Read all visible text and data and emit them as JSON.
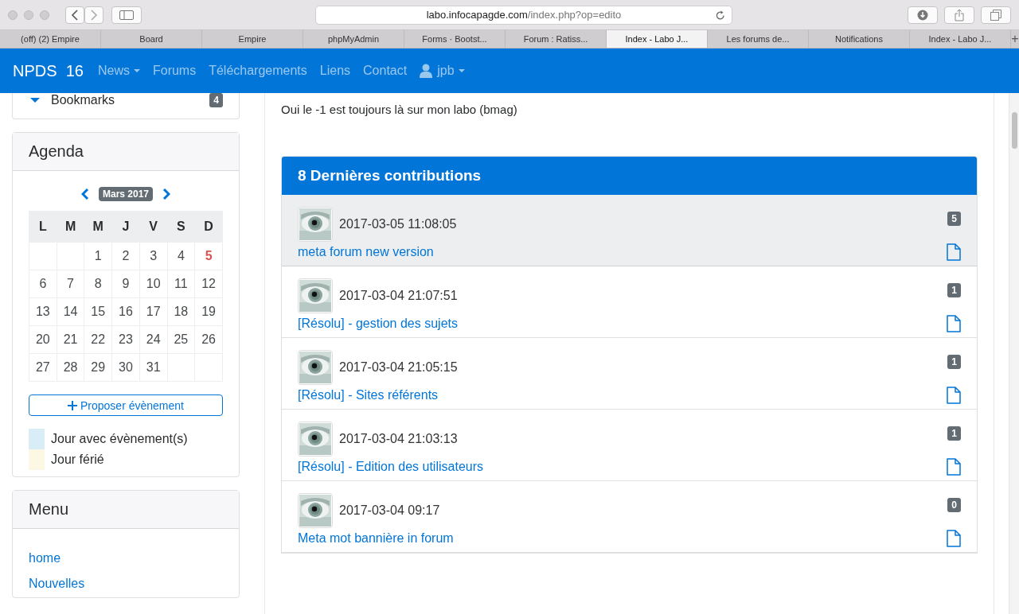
{
  "browser": {
    "address": {
      "host": "labo.infocapagde.com",
      "path": "/index.php?op=edito"
    },
    "tabs": [
      {
        "label": "(off) (2) Empire",
        "selected": false
      },
      {
        "label": "Board",
        "selected": false
      },
      {
        "label": "Empire",
        "selected": false
      },
      {
        "label": "phpMyAdmin",
        "selected": false
      },
      {
        "label": "Forms · Bootst...",
        "selected": false
      },
      {
        "label": "Forum : Ratiss...",
        "selected": false
      },
      {
        "label": "Index - Labo J...",
        "selected": true
      },
      {
        "label": "Les forums de...",
        "selected": false
      },
      {
        "label": "Notifications",
        "selected": false
      },
      {
        "label": "Index - Labo J...",
        "selected": false
      }
    ],
    "new_tab": "+"
  },
  "navbar": {
    "brand": "NPDS  16",
    "items": [
      {
        "label": "News",
        "dropdown": true
      },
      {
        "label": "Forums",
        "dropdown": false
      },
      {
        "label": "Téléchargements",
        "dropdown": false
      },
      {
        "label": "Liens",
        "dropdown": false
      },
      {
        "label": "Contact",
        "dropdown": false
      }
    ],
    "user": {
      "label": "jpb",
      "dropdown": true
    }
  },
  "sidebar": {
    "bookmarks": {
      "label": "Bookmarks",
      "count": "4"
    },
    "agenda": {
      "title": "Agenda",
      "month": "Mars 2017",
      "weekdays": [
        "L",
        "M",
        "M",
        "J",
        "V",
        "S",
        "D"
      ],
      "weeks": [
        [
          {
            "kind": "blank"
          },
          {
            "kind": "blank"
          },
          {
            "kind": "day",
            "day": "1",
            "today": false
          },
          {
            "kind": "day",
            "day": "2",
            "today": false
          },
          {
            "kind": "day",
            "day": "3",
            "today": false
          },
          {
            "kind": "day",
            "day": "4",
            "today": false
          },
          {
            "kind": "day",
            "day": "5",
            "today": true
          }
        ],
        [
          {
            "kind": "day",
            "day": "6",
            "today": false
          },
          {
            "kind": "day",
            "day": "7",
            "today": false
          },
          {
            "kind": "day",
            "day": "8",
            "today": false
          },
          {
            "kind": "day",
            "day": "9",
            "today": false
          },
          {
            "kind": "day",
            "day": "10",
            "today": false
          },
          {
            "kind": "day",
            "day": "11",
            "today": false
          },
          {
            "kind": "day",
            "day": "12",
            "today": false
          }
        ],
        [
          {
            "kind": "day",
            "day": "13",
            "today": false
          },
          {
            "kind": "day",
            "day": "14",
            "today": false
          },
          {
            "kind": "day",
            "day": "15",
            "today": false
          },
          {
            "kind": "day",
            "day": "16",
            "today": false
          },
          {
            "kind": "day",
            "day": "17",
            "today": false
          },
          {
            "kind": "day",
            "day": "18",
            "today": false
          },
          {
            "kind": "day",
            "day": "19",
            "today": false
          }
        ],
        [
          {
            "kind": "day",
            "day": "20",
            "today": false
          },
          {
            "kind": "day",
            "day": "21",
            "today": false
          },
          {
            "kind": "day",
            "day": "22",
            "today": false
          },
          {
            "kind": "day",
            "day": "23",
            "today": false
          },
          {
            "kind": "day",
            "day": "24",
            "today": false
          },
          {
            "kind": "day",
            "day": "25",
            "today": false
          },
          {
            "kind": "day",
            "day": "26",
            "today": false
          }
        ],
        [
          {
            "kind": "day",
            "day": "27",
            "today": false
          },
          {
            "kind": "day",
            "day": "28",
            "today": false
          },
          {
            "kind": "day",
            "day": "29",
            "today": false
          },
          {
            "kind": "day",
            "day": "30",
            "today": false
          },
          {
            "kind": "day",
            "day": "31",
            "today": false
          },
          {
            "kind": "blank"
          },
          {
            "kind": "blank"
          }
        ]
      ],
      "propose_button": "Proposer évènement",
      "legend": [
        {
          "label": "Jour avec évènement(s)",
          "color": "#d9edf7"
        },
        {
          "label": "Jour férié",
          "color": "#fcf8e3"
        }
      ]
    },
    "menu": {
      "title": "Menu",
      "links": [
        "home",
        "Nouvelles"
      ]
    }
  },
  "main": {
    "intro": "Oui le -1 est toujours là sur mon labo (bmag)",
    "contributions": {
      "title": "8 Dernières contributions",
      "posts": [
        {
          "date": "2017-03-05 11:08:05",
          "count": "5",
          "title": "meta forum new version",
          "selected": true
        },
        {
          "date": "2017-03-04 21:07:51",
          "count": "1",
          "title": "[Résolu] - gestion des sujets",
          "selected": false
        },
        {
          "date": "2017-03-04 21:05:15",
          "count": "1",
          "title": "[Résolu] - Sites référents",
          "selected": false
        },
        {
          "date": "2017-03-04 21:03:13",
          "count": "1",
          "title": "[Résolu] - Edition des utilisateurs",
          "selected": false
        },
        {
          "date": "2017-03-04 09:17",
          "count": "0",
          "title": "Meta mot bannière in forum",
          "selected": false
        }
      ]
    }
  }
}
